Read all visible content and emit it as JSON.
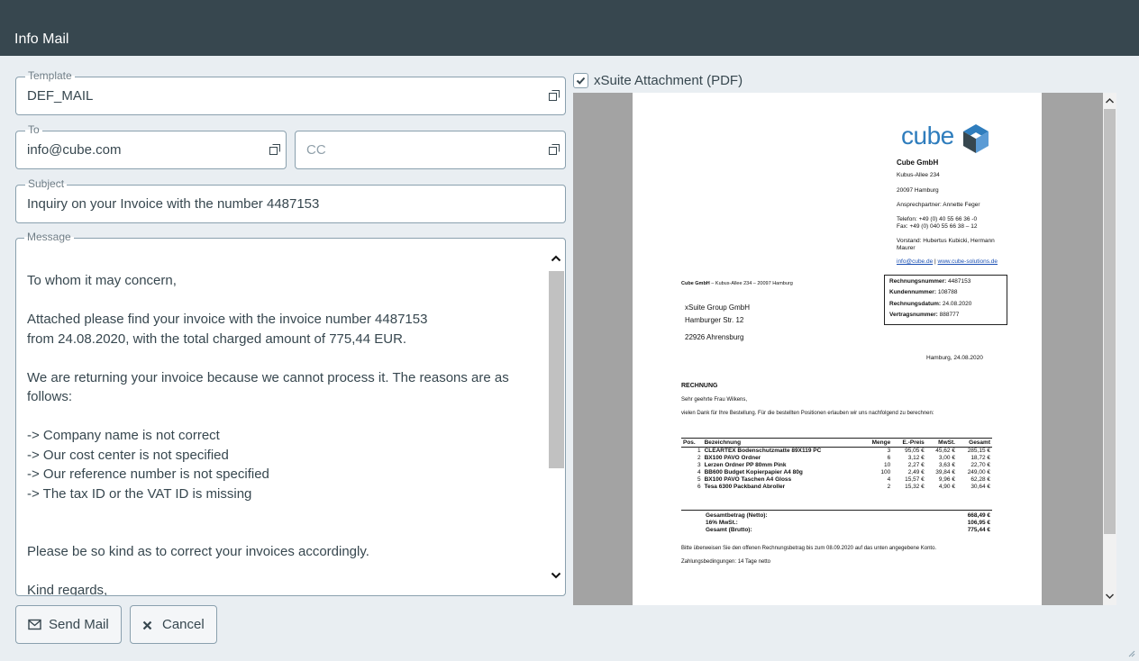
{
  "window": {
    "title": "Info Mail"
  },
  "template": {
    "label": "Template",
    "value": "DEF_MAIL"
  },
  "to": {
    "label": "To",
    "value": "info@cube.com"
  },
  "cc": {
    "placeholder": "CC"
  },
  "subject": {
    "label": "Subject",
    "value": "Inquiry on your Invoice with the number 4487153"
  },
  "message": {
    "label": "Message",
    "lines": [
      "To whom it may concern,",
      "",
      "Attached please find your invoice with the invoice number 4487153",
      "from 24.08.2020, with the total charged amount of 775,44 EUR.",
      "",
      "We are returning your invoice because we cannot process it. The reasons are as",
      "follows:",
      "",
      "-> Company name is not correct",
      "-> Our cost center is not specified",
      "-> Our reference number is not specified",
      "-> The tax ID or the VAT ID is missing",
      "",
      "",
      "Please be so kind as to correct your invoices accordingly.",
      "",
      "Kind regards,"
    ]
  },
  "buttons": {
    "send": "Send Mail",
    "cancel": "Cancel"
  },
  "attachment": {
    "label": "xSuite Attachment (PDF)",
    "checked": true
  },
  "pdf": {
    "logo_text": "cube",
    "company": "Cube GmbH",
    "street": "Kubus-Allee 234",
    "city": "20097 Hamburg",
    "contact": "Ansprechpartner: Annette Feger",
    "phone": "Telefon: +49 (0) 40 55 66 36 -0",
    "fax": "Fax: +49 (0) 040 55 66 38 – 12",
    "board_1": "Vorstand: Hubertus Kubicki, Hermann",
    "board_2": "Maurer",
    "email": "info@cube.de",
    "sep": "|",
    "web": "www.cube-solutions.de",
    "sender_line_bold": "Cube GmbH",
    "sender_line_rest": " – Kubus-Allee 234 – 20097 Hamburg",
    "recipient_1": "xSuite Group GmbH",
    "recipient_2": "Hamburger Str. 12",
    "recipient_3": "22926 Ahrensburg",
    "info": [
      {
        "label": "Rechnungsnummer:",
        "value": "4487153"
      },
      {
        "label": "Kundennummer:",
        "value": "108788"
      },
      {
        "label": "Rechnungsdatum:",
        "value": "24.08.2020"
      },
      {
        "label": "Vertragsnummer:",
        "value": "888777"
      }
    ],
    "place_date": "Hamburg, 24.08.2020",
    "heading": "RECHNUNG",
    "salutation": "Sehr geehrte Frau Wilkens,",
    "intro": "vielen Dank für Ihre Bestellung. Für die bestellten Positionen erlauben wir uns nachfolgend zu berechnen:",
    "columns": [
      "Pos.",
      "Bezeichnung",
      "Menge",
      "E.-Preis",
      "MwSt.",
      "Gesamt"
    ],
    "rows": [
      [
        "1",
        "CLEARTEX Bodenschutzmatte 89X119 PC",
        "3",
        "95,05 €",
        "45,62 €",
        "285,15 €"
      ],
      [
        "2",
        "BX100 PAVO Ordner",
        "6",
        "3,12 €",
        "3,00 €",
        "18,72 €"
      ],
      [
        "3",
        "Lerzen Ordner PP 80mm Pink",
        "10",
        "2,27 €",
        "3,63 €",
        "22,70 €"
      ],
      [
        "4",
        "BB600 Budget Kopierpapier A4 80g",
        "100",
        "2,49 €",
        "39,84 €",
        "249,00 €"
      ],
      [
        "5",
        "BX100 PAVO Taschen A4 Gloss",
        "4",
        "15,57 €",
        "9,96 €",
        "62,28 €"
      ],
      [
        "6",
        "Tesa 6300 Packband Abroller",
        "2",
        "15,32 €",
        "4,90 €",
        "30,64 €"
      ]
    ],
    "totals": [
      {
        "label": "Gesamtbetrag (Netto):",
        "value": "668,49 €"
      },
      {
        "label": "16% MwSt.:",
        "value": "106,95 €"
      },
      {
        "label": "Gesamt (Brutto):",
        "value": "775,44 €"
      }
    ],
    "payment_note": "Bitte überweisen Sie den offenen Rechnungsbetrag bis zum 08.09.2020 auf das unten angegebene Konto.",
    "terms": "Zahlungsbedingungen: 14 Tage netto"
  },
  "colors": {
    "titlebar": "#37474f",
    "background": "#e9eef2",
    "border": "#8aa0ae",
    "logo_blue": "#2f7dbd"
  }
}
